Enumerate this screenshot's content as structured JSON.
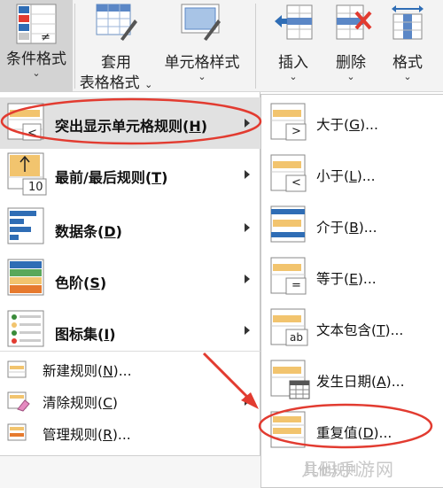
{
  "ribbon": {
    "conditional_format": {
      "label": "条件格式"
    },
    "table_format": {
      "line1": "套用",
      "line2": "表格格式"
    },
    "cell_styles": {
      "label": "单元格样式"
    },
    "insert": {
      "label": "插入"
    },
    "delete": {
      "label": "删除"
    },
    "format": {
      "label": "格式"
    },
    "chevron": "⌄"
  },
  "menu": {
    "items": [
      {
        "label": "突出显示单元格规则(",
        "key": "H",
        "suffix": ")"
      },
      {
        "label": "最前/最后规则(",
        "key": "T",
        "suffix": ")",
        "icon_number": "10"
      },
      {
        "label": "数据条(",
        "key": "D",
        "suffix": ")"
      },
      {
        "label": "色阶(",
        "key": "S",
        "suffix": ")"
      },
      {
        "label": "图标集(",
        "key": "I",
        "suffix": ")"
      }
    ],
    "small_items": [
      {
        "label": "新建规则(",
        "key": "N",
        "suffix": ")..."
      },
      {
        "label": "清除规则(",
        "key": "C",
        "suffix": ")"
      },
      {
        "label": "管理规则(",
        "key": "R",
        "suffix": ")..."
      }
    ]
  },
  "submenu": {
    "items": [
      {
        "label": "大于(",
        "key": "G",
        "suffix": ")...",
        "icon_glyph": ">"
      },
      {
        "label": "小于(",
        "key": "L",
        "suffix": ")...",
        "icon_glyph": "<"
      },
      {
        "label": "介于(",
        "key": "B",
        "suffix": ")..."
      },
      {
        "label": "等于(",
        "key": "E",
        "suffix": ")...",
        "icon_glyph": "="
      },
      {
        "label": "文本包含(",
        "key": "T",
        "suffix": ")...",
        "icon_glyph": "ab"
      },
      {
        "label": "发生日期(",
        "key": "A",
        "suffix": ")..."
      },
      {
        "label": "重复值(",
        "key": "D",
        "suffix": ")..."
      }
    ],
    "partial_text": "其他规则"
  },
  "watermark": "几码手游网",
  "colors": {
    "highlight_ring": "#e23b30",
    "accent_blue": "#2f6db5",
    "accent_orange": "#f2c46e",
    "menu_highlight": "#e1e1e1"
  }
}
